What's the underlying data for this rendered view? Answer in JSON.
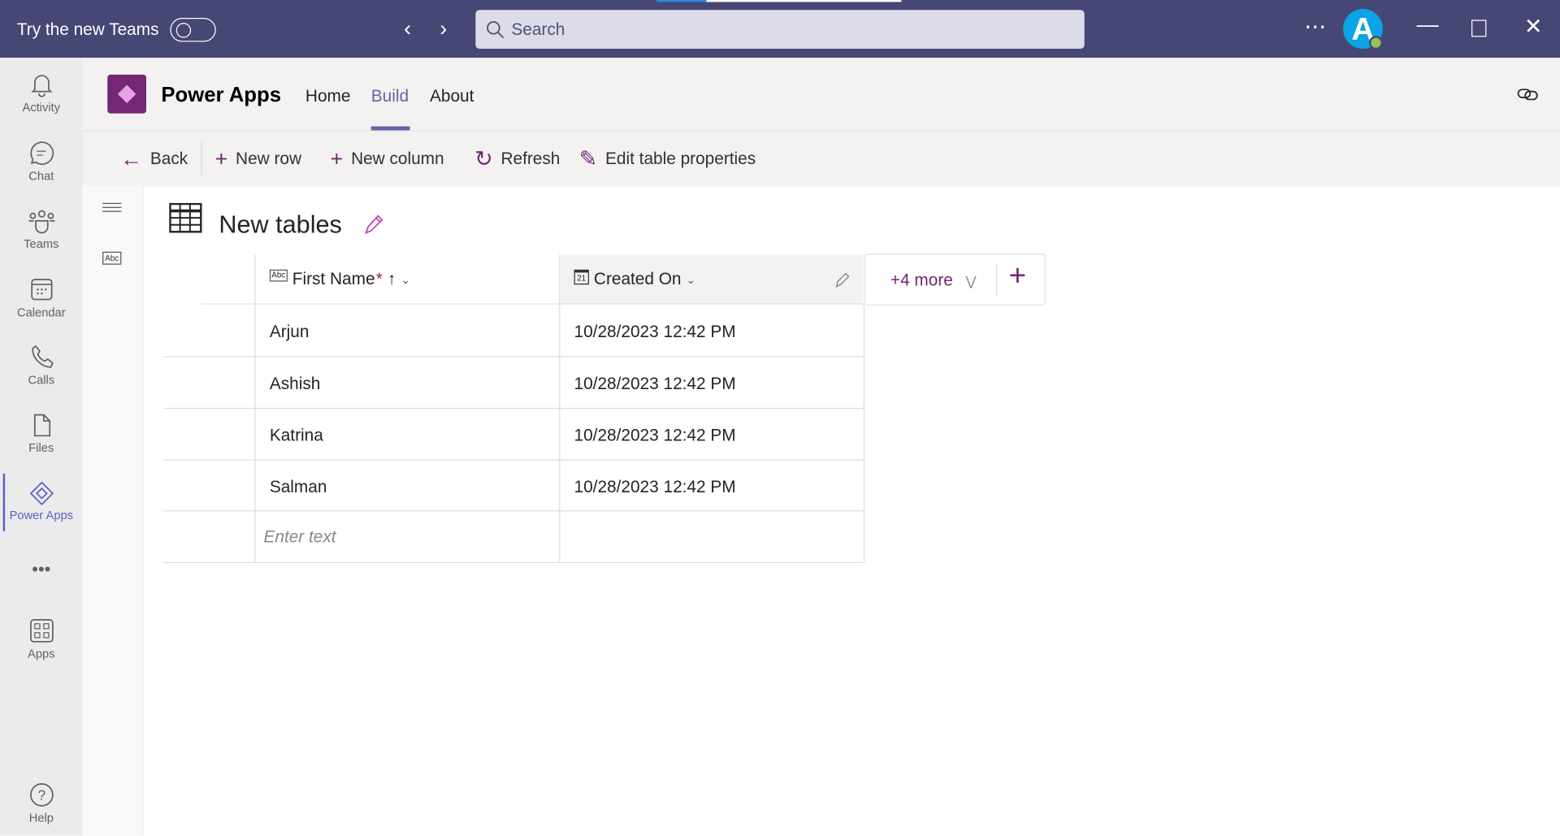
{
  "titlebar": {
    "try_new_teams": "Try the new Teams",
    "search_placeholder": "Search",
    "avatar_initial": "A"
  },
  "rail": {
    "items": [
      {
        "label": "Activity"
      },
      {
        "label": "Chat"
      },
      {
        "label": "Teams"
      },
      {
        "label": "Calendar"
      },
      {
        "label": "Calls"
      },
      {
        "label": "Files"
      },
      {
        "label": "Power Apps"
      },
      {
        "label": "Apps"
      },
      {
        "label": "Help"
      }
    ]
  },
  "app": {
    "name": "Power Apps",
    "tabs": [
      {
        "label": "Home"
      },
      {
        "label": "Build"
      },
      {
        "label": "About"
      }
    ],
    "active_tab": "Build"
  },
  "toolbar": {
    "back": "Back",
    "new_row": "New row",
    "new_column": "New column",
    "refresh": "Refresh",
    "edit_props": "Edit table properties"
  },
  "sidepanel": {
    "abc_label": "Abc"
  },
  "table": {
    "title": "New tables",
    "columns": [
      {
        "label": "First Name",
        "required": "*",
        "type_label": "Abc"
      },
      {
        "label": "Created On",
        "type_label": "21"
      }
    ],
    "more_label": "+4 more",
    "rows": [
      {
        "first_name": "Arjun",
        "created_on": "10/28/2023 12:42 PM"
      },
      {
        "first_name": "Ashish",
        "created_on": "10/28/2023 12:42 PM"
      },
      {
        "first_name": "Katrina",
        "created_on": "10/28/2023 12:42 PM"
      },
      {
        "first_name": "Salman",
        "created_on": "10/28/2023 12:42 PM"
      }
    ],
    "new_row_placeholder": "Enter text"
  },
  "colors": {
    "titlebar": "#464775",
    "accent": "#6264a7",
    "brand": "#742774"
  }
}
